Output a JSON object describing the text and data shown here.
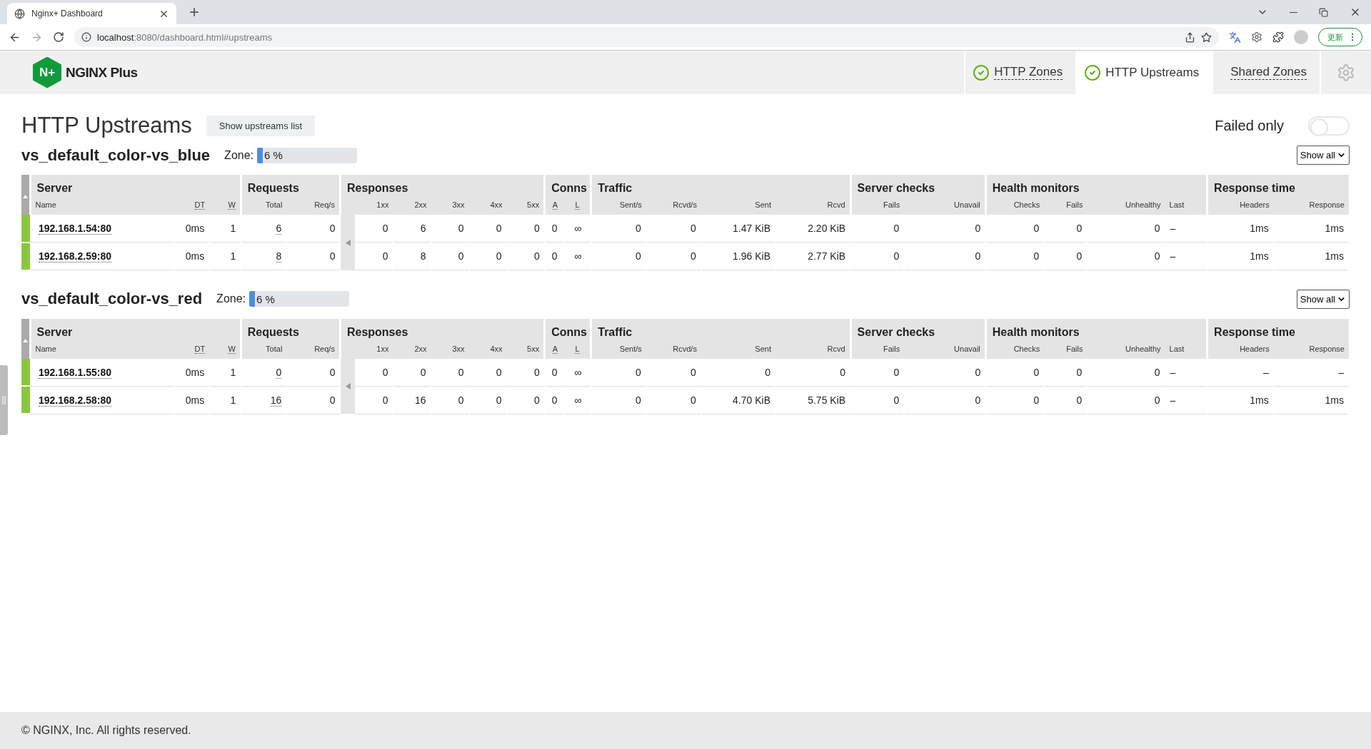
{
  "browser": {
    "tab_title": "Nginx+ Dashboard",
    "url_host": "localhost",
    "url_rest": ":8080/dashboard.html#upstreams",
    "update_button": "更新"
  },
  "header": {
    "logo_mark": "N+",
    "logo_text": "NGINX Plus",
    "nav": [
      {
        "label": "HTTP Zones",
        "ok": true,
        "selected": false
      },
      {
        "label": "HTTP Upstreams",
        "ok": true,
        "selected": true
      },
      {
        "label": "Shared Zones",
        "ok": false,
        "selected": false
      }
    ]
  },
  "page": {
    "title": "HTTP Upstreams",
    "list_button": "Show upstreams list",
    "failed_only": {
      "label": "Failed only",
      "on": false
    }
  },
  "upstreams": [
    {
      "name": "vs_default_color-vs_blue",
      "zone_label": "Zone:",
      "zone_reading": "6 %",
      "level": 0.06,
      "filter": "Show all",
      "groups": [
        {
          "label": "Server",
          "columns": [
            "Name",
            "DT",
            "W"
          ]
        },
        {
          "label": "Requests",
          "columns": [
            "Total",
            "Req/s"
          ]
        },
        {
          "label": "Responses",
          "columns": [
            "1xx",
            "2xx",
            "3xx",
            "4xx",
            "5xx"
          ]
        },
        {
          "label": "Conns",
          "columns": [
            "A",
            "L"
          ]
        },
        {
          "label": "Traffic",
          "columns": [
            "Sent/s",
            "Rcvd/s",
            "Sent",
            "Rcvd"
          ]
        },
        {
          "label": "Server checks",
          "columns": [
            "Fails",
            "Unavail"
          ]
        },
        {
          "label": "Health monitors",
          "columns": [
            "Checks",
            "Fails",
            "Unhealthy",
            "Last"
          ]
        },
        {
          "label": "Response time",
          "columns": [
            "Headers",
            "Response"
          ]
        }
      ],
      "rows": [
        {
          "color": "#8cc63f",
          "cells": [
            "192.168.1.54:80",
            "0ms",
            "1",
            "6",
            "0",
            "0",
            "6",
            "0",
            "0",
            "0",
            "0",
            "∞",
            "0",
            "0",
            "1.47 KiB",
            "2.20 KiB",
            "0",
            "0",
            "0",
            "0",
            "0",
            "–",
            "1ms",
            "1ms"
          ]
        },
        {
          "color": "#8cc63f",
          "cells": [
            "192.168.2.59:80",
            "0ms",
            "1",
            "8",
            "0",
            "0",
            "8",
            "0",
            "0",
            "0",
            "0",
            "∞",
            "0",
            "0",
            "1.96 KiB",
            "2.77 KiB",
            "0",
            "0",
            "0",
            "0",
            "0",
            "–",
            "1ms",
            "1ms"
          ]
        }
      ]
    },
    {
      "name": "vs_default_color-vs_red",
      "zone_label": "Zone:",
      "zone_reading": "6 %",
      "level": 0.06,
      "filter": "Show all",
      "groups": [
        {
          "label": "Server",
          "columns": [
            "Name",
            "DT",
            "W"
          ]
        },
        {
          "label": "Requests",
          "columns": [
            "Total",
            "Req/s"
          ]
        },
        {
          "label": "Responses",
          "columns": [
            "1xx",
            "2xx",
            "3xx",
            "4xx",
            "5xx"
          ]
        },
        {
          "label": "Conns",
          "columns": [
            "A",
            "L"
          ]
        },
        {
          "label": "Traffic",
          "columns": [
            "Sent/s",
            "Rcvd/s",
            "Sent",
            "Rcvd"
          ]
        },
        {
          "label": "Server checks",
          "columns": [
            "Fails",
            "Unavail"
          ]
        },
        {
          "label": "Health monitors",
          "columns": [
            "Checks",
            "Fails",
            "Unhealthy",
            "Last"
          ]
        },
        {
          "label": "Response time",
          "columns": [
            "Headers",
            "Response"
          ]
        }
      ],
      "rows": [
        {
          "color": "#8cc63f",
          "cells": [
            "192.168.1.55:80",
            "0ms",
            "1",
            "0",
            "0",
            "0",
            "0",
            "0",
            "0",
            "0",
            "0",
            "∞",
            "0",
            "0",
            "0",
            "0",
            "0",
            "0",
            "0",
            "0",
            "0",
            "–",
            "–",
            "–"
          ]
        },
        {
          "color": "#8cc63f",
          "cells": [
            "192.168.2.58:80",
            "0ms",
            "1",
            "16",
            "0",
            "0",
            "16",
            "0",
            "0",
            "0",
            "0",
            "∞",
            "0",
            "0",
            "4.70 KiB",
            "5.75 KiB",
            "0",
            "0",
            "0",
            "0",
            "0",
            "–",
            "1ms",
            "1ms"
          ]
        }
      ]
    }
  ],
  "footer": "© NGINX, Inc. All rights reserved."
}
